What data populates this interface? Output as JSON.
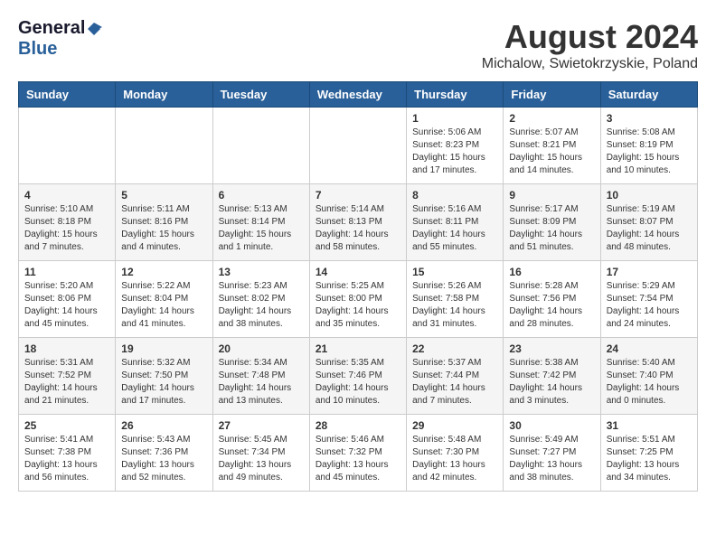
{
  "header": {
    "logo_general": "General",
    "logo_blue": "Blue",
    "month_title": "August 2024",
    "location": "Michalow, Swietokrzyskie, Poland"
  },
  "days_of_week": [
    "Sunday",
    "Monday",
    "Tuesday",
    "Wednesday",
    "Thursday",
    "Friday",
    "Saturday"
  ],
  "weeks": [
    [
      {
        "day": "",
        "info": ""
      },
      {
        "day": "",
        "info": ""
      },
      {
        "day": "",
        "info": ""
      },
      {
        "day": "",
        "info": ""
      },
      {
        "day": "1",
        "info": "Sunrise: 5:06 AM\nSunset: 8:23 PM\nDaylight: 15 hours\nand 17 minutes."
      },
      {
        "day": "2",
        "info": "Sunrise: 5:07 AM\nSunset: 8:21 PM\nDaylight: 15 hours\nand 14 minutes."
      },
      {
        "day": "3",
        "info": "Sunrise: 5:08 AM\nSunset: 8:19 PM\nDaylight: 15 hours\nand 10 minutes."
      }
    ],
    [
      {
        "day": "4",
        "info": "Sunrise: 5:10 AM\nSunset: 8:18 PM\nDaylight: 15 hours\nand 7 minutes."
      },
      {
        "day": "5",
        "info": "Sunrise: 5:11 AM\nSunset: 8:16 PM\nDaylight: 15 hours\nand 4 minutes."
      },
      {
        "day": "6",
        "info": "Sunrise: 5:13 AM\nSunset: 8:14 PM\nDaylight: 15 hours\nand 1 minute."
      },
      {
        "day": "7",
        "info": "Sunrise: 5:14 AM\nSunset: 8:13 PM\nDaylight: 14 hours\nand 58 minutes."
      },
      {
        "day": "8",
        "info": "Sunrise: 5:16 AM\nSunset: 8:11 PM\nDaylight: 14 hours\nand 55 minutes."
      },
      {
        "day": "9",
        "info": "Sunrise: 5:17 AM\nSunset: 8:09 PM\nDaylight: 14 hours\nand 51 minutes."
      },
      {
        "day": "10",
        "info": "Sunrise: 5:19 AM\nSunset: 8:07 PM\nDaylight: 14 hours\nand 48 minutes."
      }
    ],
    [
      {
        "day": "11",
        "info": "Sunrise: 5:20 AM\nSunset: 8:06 PM\nDaylight: 14 hours\nand 45 minutes."
      },
      {
        "day": "12",
        "info": "Sunrise: 5:22 AM\nSunset: 8:04 PM\nDaylight: 14 hours\nand 41 minutes."
      },
      {
        "day": "13",
        "info": "Sunrise: 5:23 AM\nSunset: 8:02 PM\nDaylight: 14 hours\nand 38 minutes."
      },
      {
        "day": "14",
        "info": "Sunrise: 5:25 AM\nSunset: 8:00 PM\nDaylight: 14 hours\nand 35 minutes."
      },
      {
        "day": "15",
        "info": "Sunrise: 5:26 AM\nSunset: 7:58 PM\nDaylight: 14 hours\nand 31 minutes."
      },
      {
        "day": "16",
        "info": "Sunrise: 5:28 AM\nSunset: 7:56 PM\nDaylight: 14 hours\nand 28 minutes."
      },
      {
        "day": "17",
        "info": "Sunrise: 5:29 AM\nSunset: 7:54 PM\nDaylight: 14 hours\nand 24 minutes."
      }
    ],
    [
      {
        "day": "18",
        "info": "Sunrise: 5:31 AM\nSunset: 7:52 PM\nDaylight: 14 hours\nand 21 minutes."
      },
      {
        "day": "19",
        "info": "Sunrise: 5:32 AM\nSunset: 7:50 PM\nDaylight: 14 hours\nand 17 minutes."
      },
      {
        "day": "20",
        "info": "Sunrise: 5:34 AM\nSunset: 7:48 PM\nDaylight: 14 hours\nand 13 minutes."
      },
      {
        "day": "21",
        "info": "Sunrise: 5:35 AM\nSunset: 7:46 PM\nDaylight: 14 hours\nand 10 minutes."
      },
      {
        "day": "22",
        "info": "Sunrise: 5:37 AM\nSunset: 7:44 PM\nDaylight: 14 hours\nand 7 minutes."
      },
      {
        "day": "23",
        "info": "Sunrise: 5:38 AM\nSunset: 7:42 PM\nDaylight: 14 hours\nand 3 minutes."
      },
      {
        "day": "24",
        "info": "Sunrise: 5:40 AM\nSunset: 7:40 PM\nDaylight: 14 hours\nand 0 minutes."
      }
    ],
    [
      {
        "day": "25",
        "info": "Sunrise: 5:41 AM\nSunset: 7:38 PM\nDaylight: 13 hours\nand 56 minutes."
      },
      {
        "day": "26",
        "info": "Sunrise: 5:43 AM\nSunset: 7:36 PM\nDaylight: 13 hours\nand 52 minutes."
      },
      {
        "day": "27",
        "info": "Sunrise: 5:45 AM\nSunset: 7:34 PM\nDaylight: 13 hours\nand 49 minutes."
      },
      {
        "day": "28",
        "info": "Sunrise: 5:46 AM\nSunset: 7:32 PM\nDaylight: 13 hours\nand 45 minutes."
      },
      {
        "day": "29",
        "info": "Sunrise: 5:48 AM\nSunset: 7:30 PM\nDaylight: 13 hours\nand 42 minutes."
      },
      {
        "day": "30",
        "info": "Sunrise: 5:49 AM\nSunset: 7:27 PM\nDaylight: 13 hours\nand 38 minutes."
      },
      {
        "day": "31",
        "info": "Sunrise: 5:51 AM\nSunset: 7:25 PM\nDaylight: 13 hours\nand 34 minutes."
      }
    ]
  ]
}
